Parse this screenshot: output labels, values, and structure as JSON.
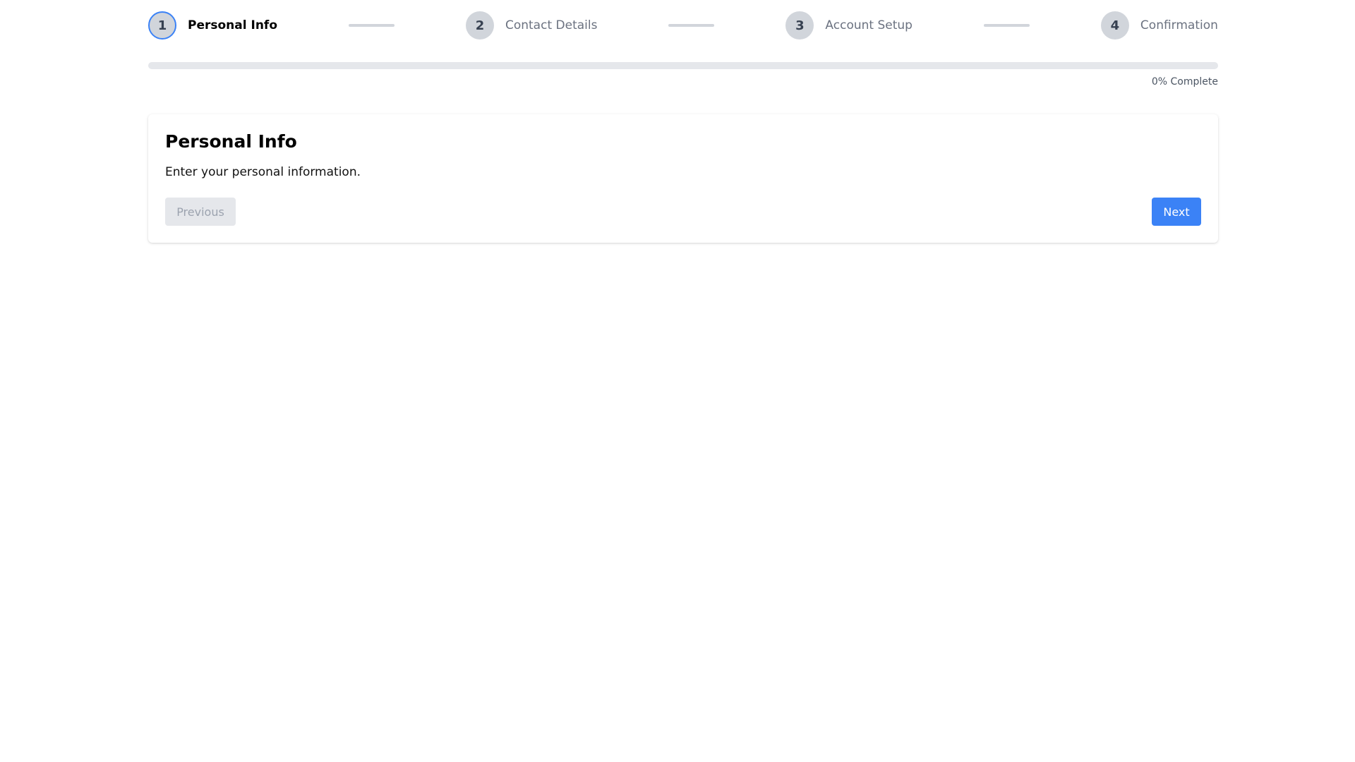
{
  "stepper": {
    "steps": [
      {
        "number": "1",
        "label": "Personal Info",
        "state": "active"
      },
      {
        "number": "2",
        "label": "Contact Details",
        "state": "pending"
      },
      {
        "number": "3",
        "label": "Account Setup",
        "state": "pending"
      },
      {
        "number": "4",
        "label": "Confirmation",
        "state": "pending"
      }
    ]
  },
  "progress": {
    "percent": 0,
    "label": "0% Complete"
  },
  "card": {
    "title": "Personal Info",
    "description": "Enter your personal information."
  },
  "actions": {
    "previous_label": "Previous",
    "next_label": "Next",
    "previous_disabled": true
  },
  "colors": {
    "accent": "#3b82f6",
    "inactive_circle": "#d1d5db",
    "track": "#e5e7eb"
  }
}
